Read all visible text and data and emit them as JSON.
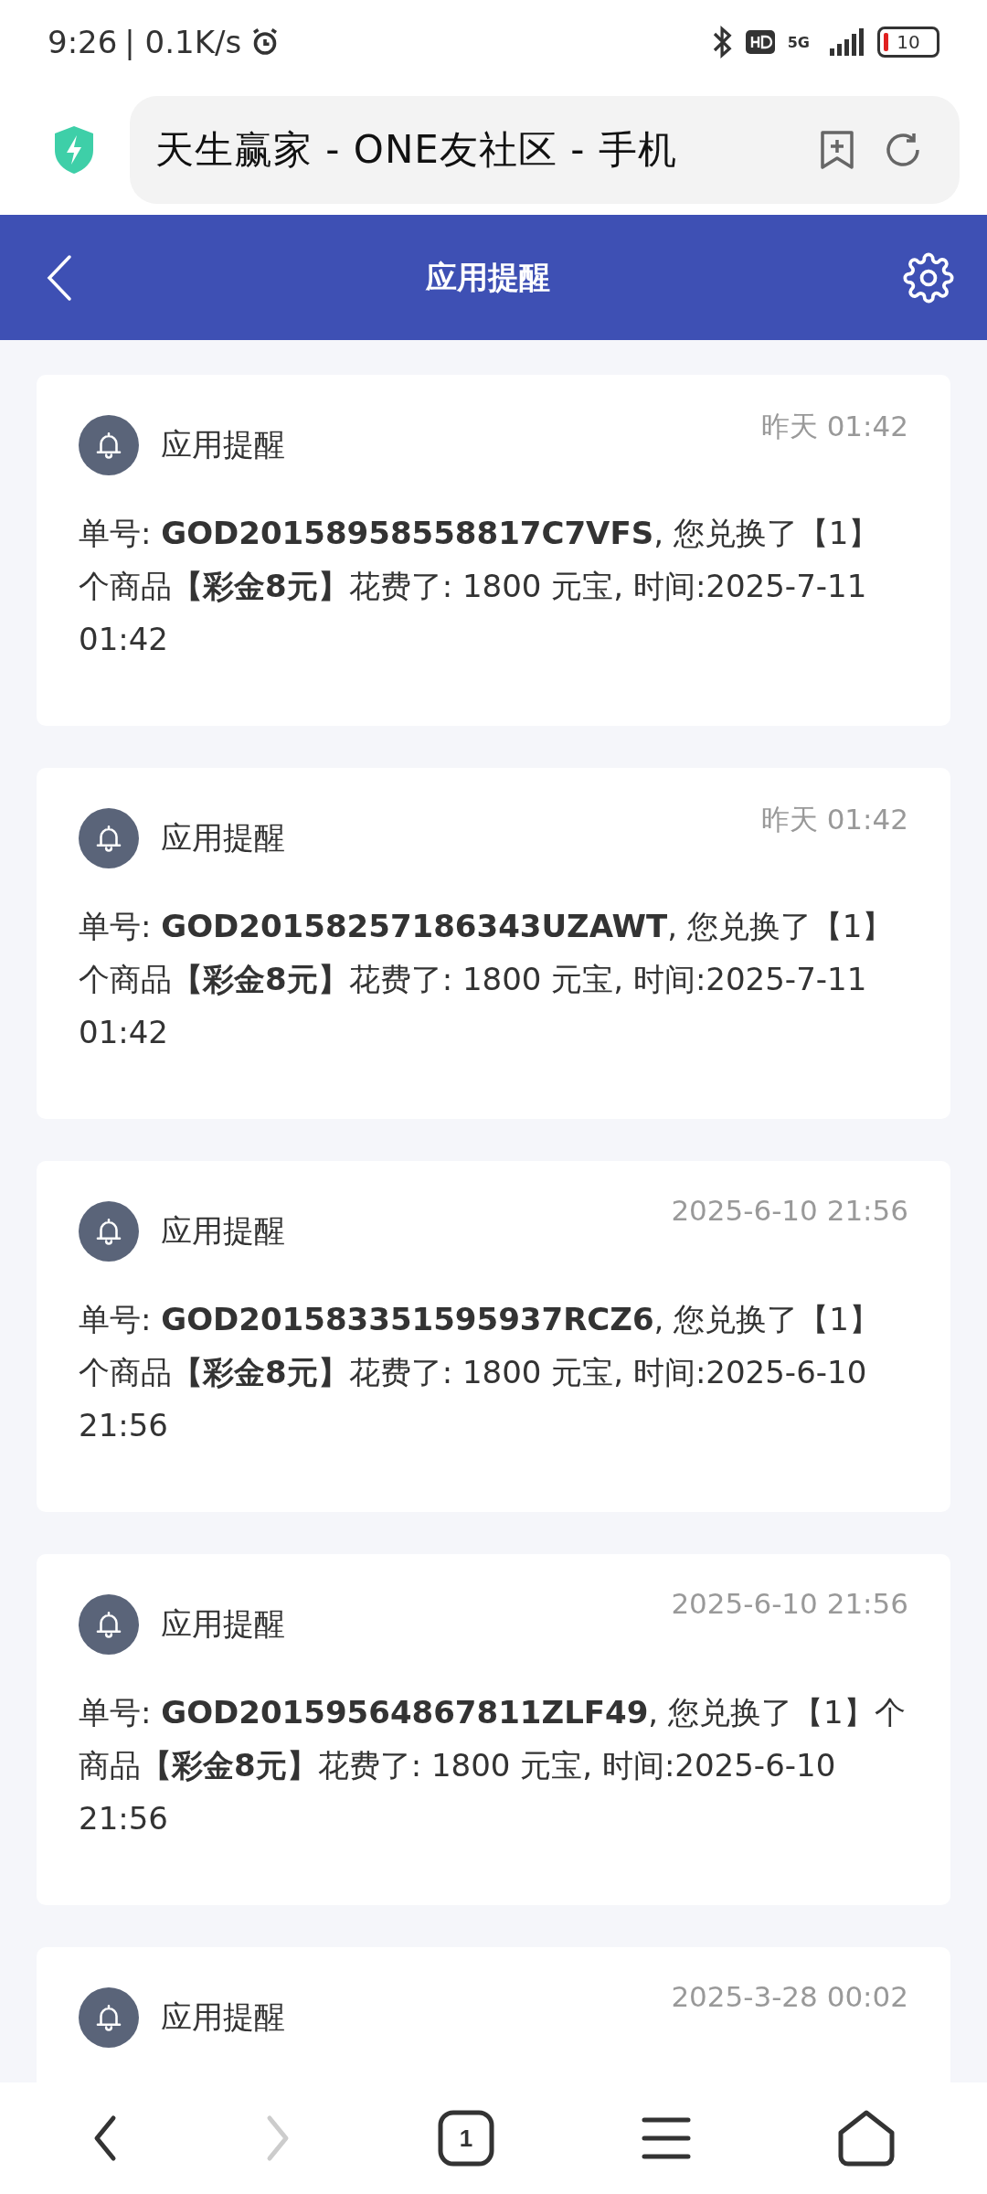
{
  "status_bar": {
    "time": "9:26",
    "speed": "| 0.1K/s",
    "network": "5G",
    "battery": {
      "label": "10",
      "level": 0.1
    }
  },
  "address_bar": {
    "title": "天生赢家 - ONE友社区 - 手机"
  },
  "header": {
    "title": "应用提醒"
  },
  "notifications": [
    {
      "sender": "应用提醒",
      "time": "昨天 01:42",
      "message": "单号: **GOD20158958558817C7VFS**, 您兑换了【1】个商品**【彩金8元】**花费了: 1800 元宝, 时间:2025-7-11 01:42"
    },
    {
      "sender": "应用提醒",
      "time": "昨天 01:42",
      "message": "单号: **GOD20158257186343UZAWT**, 您兑换了【1】个商品**【彩金8元】**花费了: 1800 元宝, 时间:2025-7-11 01:42"
    },
    {
      "sender": "应用提醒",
      "time": "2025-6-10 21:56",
      "message": "单号: **GOD201583351595937RCZ6**, 您兑换了【1】个商品**【彩金8元】**花费了: 1800 元宝, 时间:2025-6-10 21:56"
    },
    {
      "sender": "应用提醒",
      "time": "2025-6-10 21:56",
      "message": "单号: **GOD20159564867811ZLF49**, 您兑换了【1】个商品**【彩金8元】**花费了: 1800 元宝, 时间:2025-6-10 21:56"
    },
    {
      "sender": "应用提醒",
      "time": "2025-3-28 00:02"
    }
  ],
  "bottom_nav": {
    "back_disabled": false,
    "forward_disabled": true,
    "tab_count": "1"
  }
}
